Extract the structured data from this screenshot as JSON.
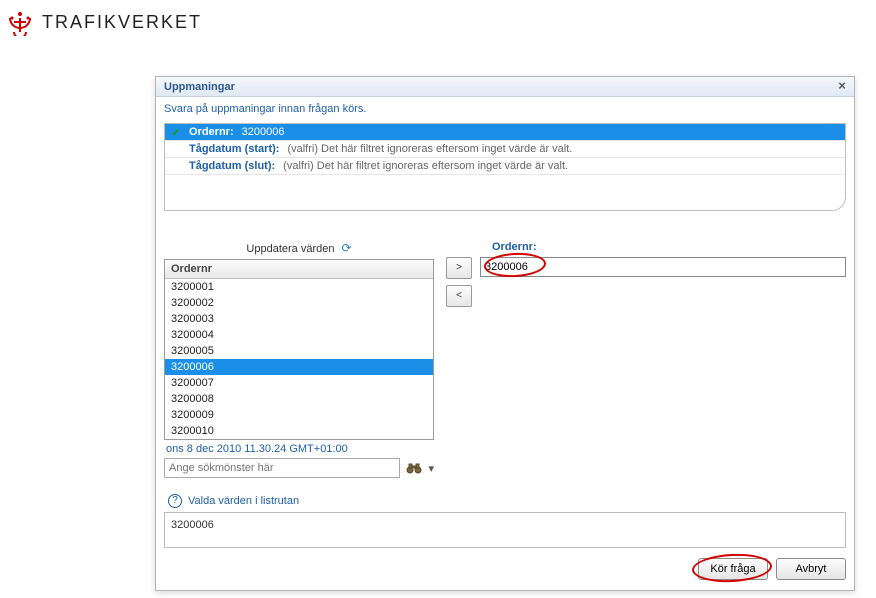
{
  "brand": {
    "text": "TRAFIKVERKET"
  },
  "dialog": {
    "title": "Uppmaningar",
    "subtitle": "Svara på uppmaningar innan frågan körs.",
    "prompts": [
      {
        "checked": true,
        "selected": true,
        "label": "Ordernr:",
        "value": "3200006",
        "hint": ""
      },
      {
        "checked": false,
        "selected": false,
        "label": "Tågdatum (start):",
        "value": "",
        "hint": "(valfri) Det här filtret ignoreras eftersom inget värde är valt."
      },
      {
        "checked": false,
        "selected": false,
        "label": "Tågdatum (slut):",
        "value": "",
        "hint": "(valfri) Det här filtret ignoreras eftersom inget värde är valt."
      }
    ]
  },
  "left": {
    "update_header": "Uppdatera värden",
    "column_header": "Ordernr",
    "items": [
      {
        "v": "3200001",
        "sel": false
      },
      {
        "v": "3200002",
        "sel": false
      },
      {
        "v": "3200003",
        "sel": false
      },
      {
        "v": "3200004",
        "sel": false
      },
      {
        "v": "3200005",
        "sel": false
      },
      {
        "v": "3200006",
        "sel": true
      },
      {
        "v": "3200007",
        "sel": false
      },
      {
        "v": "3200008",
        "sel": false
      },
      {
        "v": "3200009",
        "sel": false
      },
      {
        "v": "3200010",
        "sel": false
      }
    ],
    "timestamp": "ons 8 dec 2010 11.30.24 GMT+01:00",
    "search_placeholder": "Ange sökmönster här"
  },
  "right": {
    "field_label": "Ordernr:",
    "selected_value": "3200006"
  },
  "help": {
    "label": "Valda värden i listrutan"
  },
  "result": {
    "text": "3200006"
  },
  "buttons": {
    "run": "Kör fråga",
    "cancel": "Avbryt"
  }
}
